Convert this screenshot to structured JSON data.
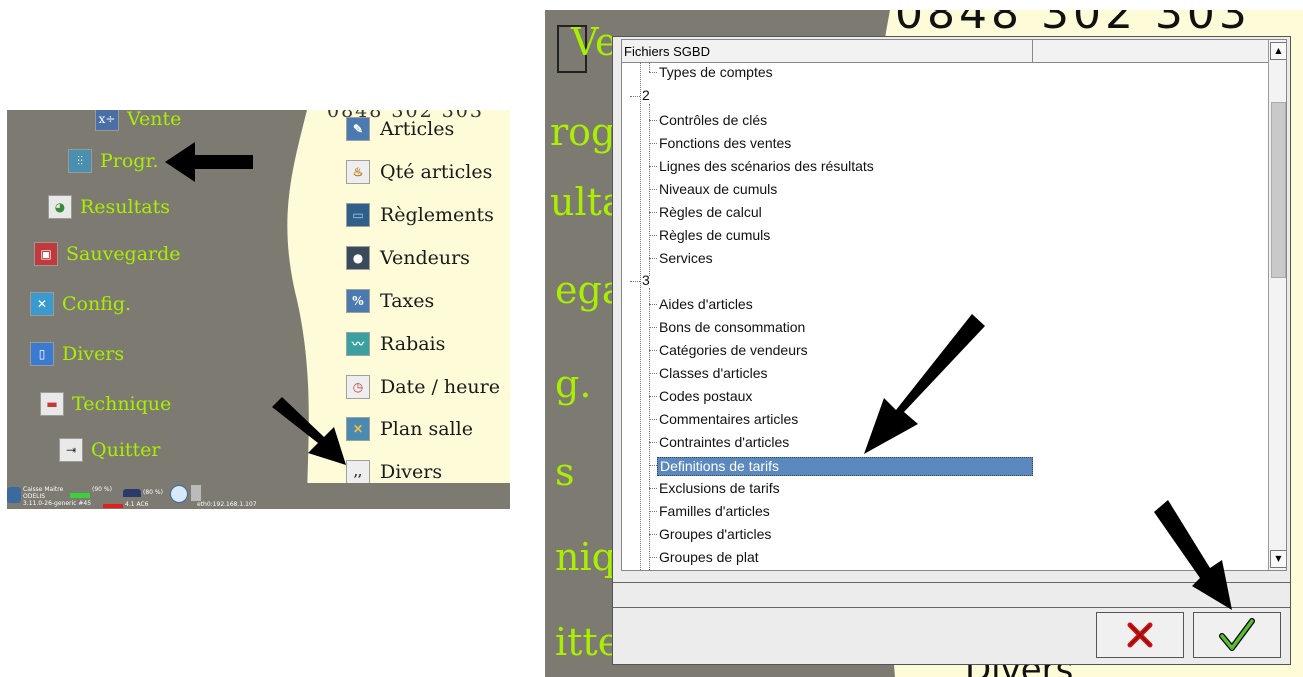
{
  "left": {
    "top_number": "0848 302 303",
    "main_menu": [
      {
        "label": "Vente",
        "icon": "calculator-icon"
      },
      {
        "label": "Progr.",
        "icon": "sliders-icon"
      },
      {
        "label": "Resultats",
        "icon": "pie-chart-icon"
      },
      {
        "label": "Sauvegarde",
        "icon": "save-icon"
      },
      {
        "label": "Config.",
        "icon": "tools-icon"
      },
      {
        "label": "Divers",
        "icon": "phone-icon"
      },
      {
        "label": "Technique",
        "icon": "toolbox-icon"
      },
      {
        "label": "Quitter",
        "icon": "exit-door-icon"
      }
    ],
    "sub_menu": [
      {
        "label": "Articles",
        "icon": "edit-icon"
      },
      {
        "label": "Qté articles",
        "icon": "basket-icon"
      },
      {
        "label": "Règlements",
        "icon": "money-icon"
      },
      {
        "label": "Vendeurs",
        "icon": "user-icon"
      },
      {
        "label": "Taxes",
        "icon": "tax-document-icon"
      },
      {
        "label": "Rabais",
        "icon": "discount-graph-icon"
      },
      {
        "label": "Date / heure",
        "icon": "clock-icon"
      },
      {
        "label": "Plan salle",
        "icon": "floor-plan-icon"
      },
      {
        "label": "Divers",
        "icon": "quote-icon"
      }
    ],
    "taskbar": {
      "app_name": "Caisse Maitre",
      "app_sub": "ODELIS",
      "version": "3.11.0-26-generic #45",
      "battery1": "(90 %)",
      "battery2": "(80 %)",
      "ac": "4.1 AC6",
      "network": "eth0:192.168.1.107"
    }
  },
  "right": {
    "bg_phone": "0848 302 303",
    "bg_divers": "Divers",
    "bg_fragments": [
      "Ve",
      "rogr",
      "ulta",
      "ega",
      "g.",
      "s",
      "niq",
      "itte"
    ],
    "dialog": {
      "column_header": "Fichiers SGBD",
      "tree": [
        {
          "label": "Types de comptes",
          "level": 2
        },
        {
          "label": "2",
          "level": 1
        },
        {
          "label": "Contrôles de clés",
          "level": 2
        },
        {
          "label": "Fonctions des ventes",
          "level": 2
        },
        {
          "label": "Lignes des scénarios des résultats",
          "level": 2
        },
        {
          "label": "Niveaux de cumuls",
          "level": 2
        },
        {
          "label": "Règles de calcul",
          "level": 2
        },
        {
          "label": "Règles de cumuls",
          "level": 2
        },
        {
          "label": "Services",
          "level": 2
        },
        {
          "label": "3",
          "level": 1
        },
        {
          "label": "Aides d'articles",
          "level": 2
        },
        {
          "label": "Bons de consommation",
          "level": 2
        },
        {
          "label": "Catégories de vendeurs",
          "level": 2
        },
        {
          "label": "Classes d'articles",
          "level": 2
        },
        {
          "label": "Codes postaux",
          "level": 2
        },
        {
          "label": "Commentaires articles",
          "level": 2
        },
        {
          "label": "Contraintes d'articles",
          "level": 2
        },
        {
          "label": "Definitions de tarifs",
          "level": 2,
          "selected": true
        },
        {
          "label": "Exclusions de tarifs",
          "level": 2
        },
        {
          "label": "Familles d'articles",
          "level": 2
        },
        {
          "label": "Groupes d'articles",
          "level": 2
        },
        {
          "label": "Groupes de plat",
          "level": 2
        }
      ],
      "cancel_icon": "red-x-icon",
      "ok_icon": "green-check-icon"
    }
  },
  "colors": {
    "panel_bg": "#7d7a72",
    "cream": "#fdfbd8",
    "menu_text": "#a8f000",
    "selection": "#5b89bd"
  }
}
